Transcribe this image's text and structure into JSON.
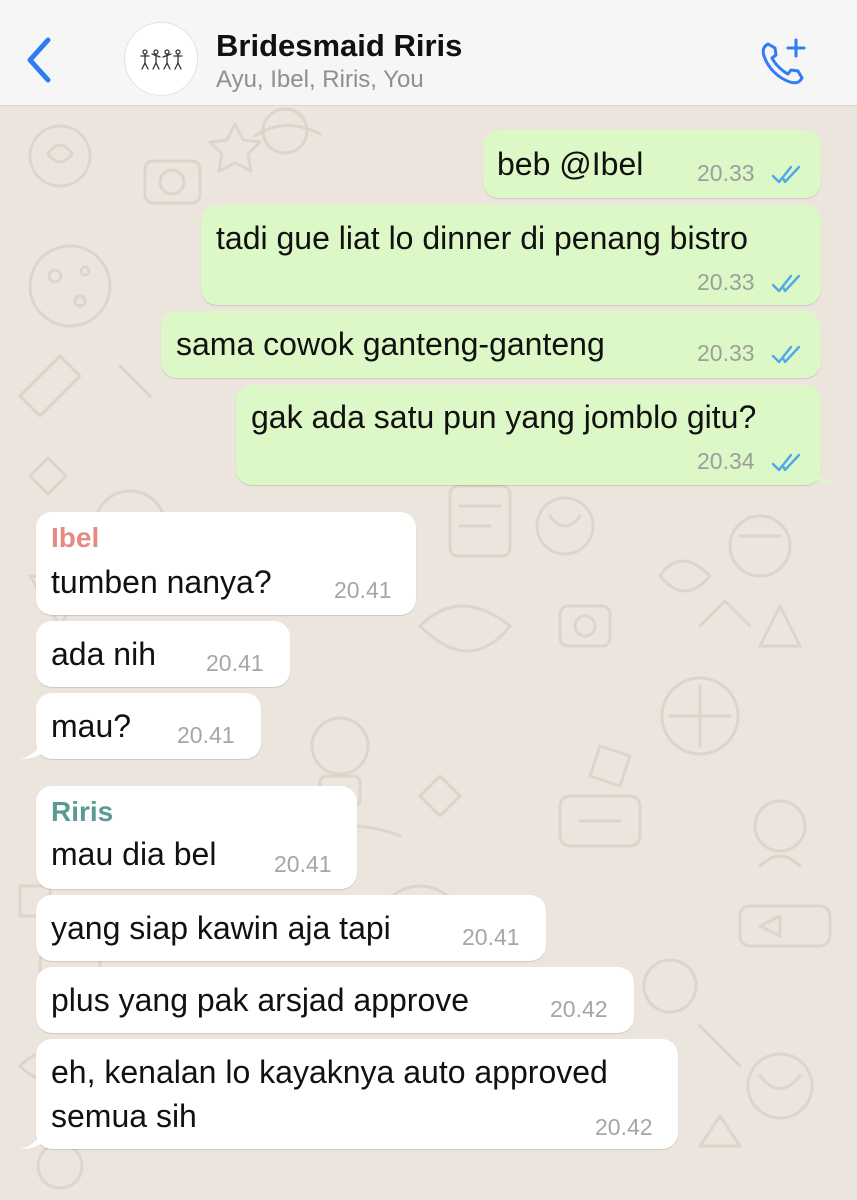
{
  "header": {
    "group_name": "Bridesmaid Riris",
    "members": "Ayu, Ibel, Riris, You",
    "back_icon": "chevron-left-icon",
    "call_icon": "add-call-icon",
    "accent_color": "#2f7cf6"
  },
  "messages": [
    {
      "direction": "outgoing",
      "text": "beb @Ibel",
      "time": "20.33",
      "status": "read"
    },
    {
      "direction": "outgoing",
      "text": "tadi gue liat lo dinner di penang bistro",
      "time": "20.33",
      "status": "read"
    },
    {
      "direction": "outgoing",
      "text": "sama cowok ganteng-ganteng",
      "time": "20.33",
      "status": "read"
    },
    {
      "direction": "outgoing",
      "text": "gak ada satu pun yang jomblo gitu?",
      "time": "20.34",
      "status": "read"
    },
    {
      "direction": "incoming",
      "sender": "Ibel",
      "sender_color": "#e58a84",
      "text": "tumben nanya?",
      "time": "20.41"
    },
    {
      "direction": "incoming",
      "text": "ada nih",
      "time": "20.41"
    },
    {
      "direction": "incoming",
      "text": "mau?",
      "time": "20.41"
    },
    {
      "direction": "incoming",
      "sender": "Riris",
      "sender_color": "#5b9a94",
      "text": "mau dia bel",
      "time": "20.41"
    },
    {
      "direction": "incoming",
      "text": "yang siap kawin aja tapi",
      "time": "20.41"
    },
    {
      "direction": "incoming",
      "text": "plus yang pak arsjad approve",
      "time": "20.42"
    },
    {
      "direction": "incoming",
      "text_line1": "eh, kenalan lo kayaknya auto approved",
      "text_line2": "semua sih",
      "time": "20.42"
    }
  ],
  "colors": {
    "outgoing_bubble": "#dcf8c6",
    "incoming_bubble": "#ffffff",
    "read_ticks": "#4fa9e8",
    "wallpaper": "#ece5dd"
  }
}
